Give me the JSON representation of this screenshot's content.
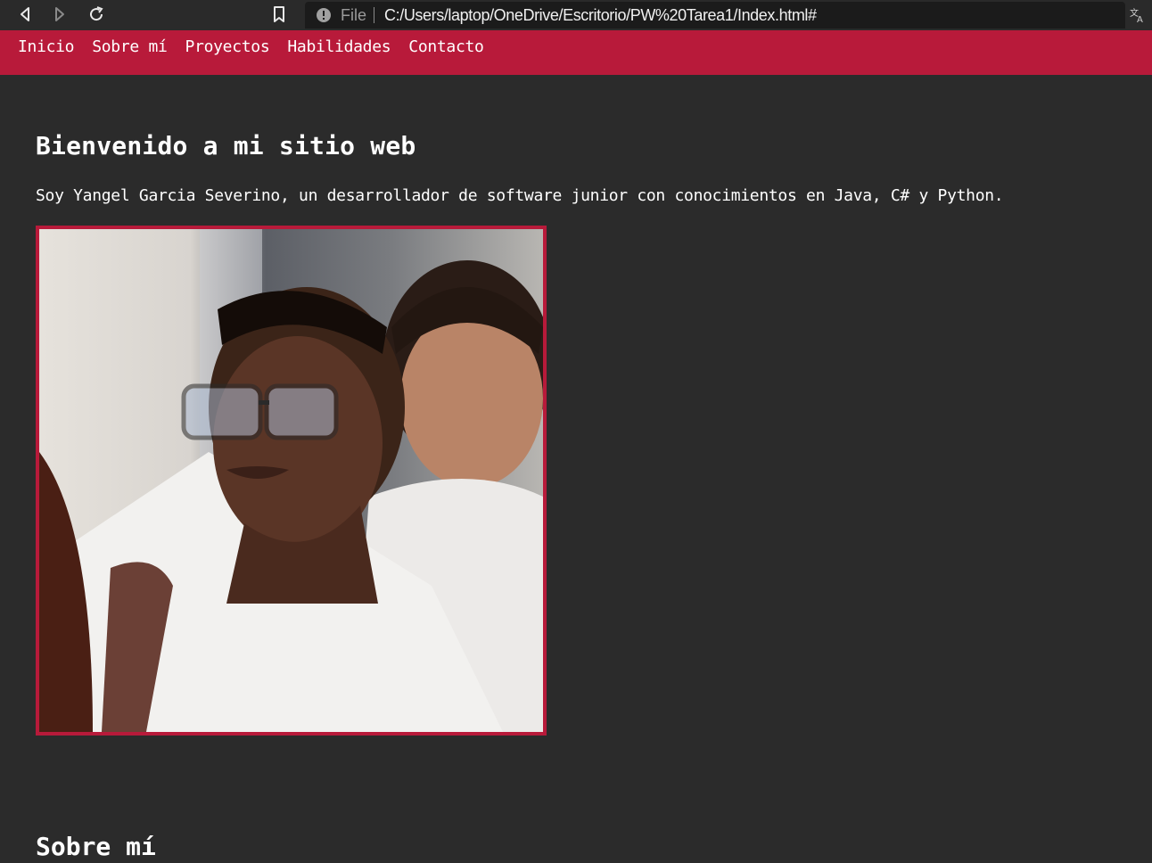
{
  "browser": {
    "file_label": "File",
    "url": "C:/Users/laptop/OneDrive/Escritorio/PW%20Tarea1/Index.html#"
  },
  "nav": {
    "items": [
      {
        "label": "Inicio"
      },
      {
        "label": "Sobre mí"
      },
      {
        "label": "Proyectos"
      },
      {
        "label": "Habilidades"
      },
      {
        "label": "Contacto"
      }
    ]
  },
  "hero": {
    "title": "Bienvenido a mi sitio web",
    "intro": "Soy Yangel Garcia Severino, un desarrollador de software junior con conocimientos en Java, C# y Python."
  },
  "about": {
    "title": "Sobre mí"
  },
  "colors": {
    "accent": "#b81a3a",
    "background": "#2b2b2b",
    "text": "#ffffff"
  }
}
